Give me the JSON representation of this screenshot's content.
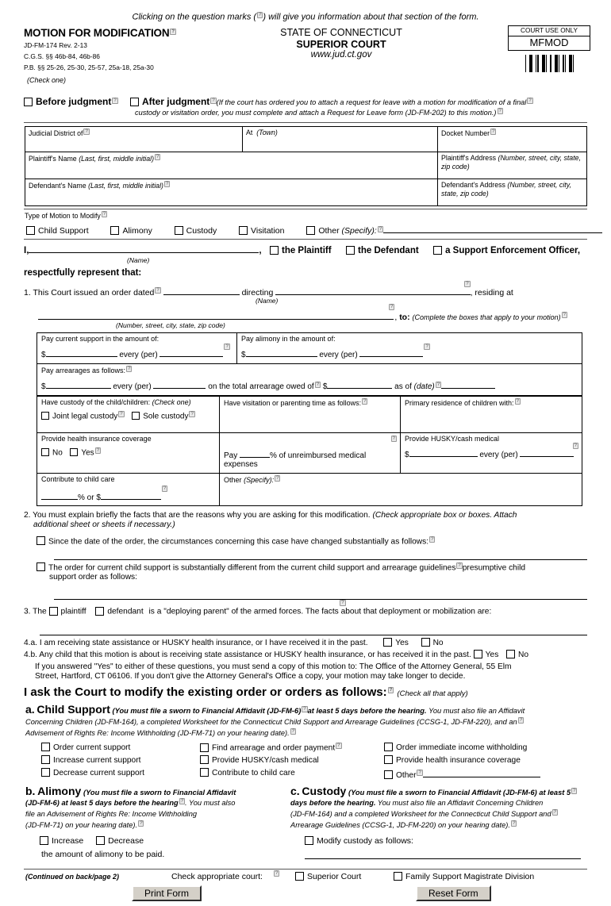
{
  "instruction": "Clicking on the question marks (  ) will give you information about that section of the form.",
  "header": {
    "title": "MOTION FOR MODIFICATION",
    "form_no": "JD-FM-174   Rev. 2-13",
    "cgs": "C.G.S. §§ 46b-84, 46b-86",
    "pb": "P.B. §§ 25-26, 25-30, 25-57, 25a-18, 25a-30",
    "check_one": "(Check one)",
    "state": "STATE OF CONNECTICUT",
    "court": "SUPERIOR COURT",
    "website": "www.jud.ct.gov",
    "court_use_only": "COURT USE ONLY",
    "court_code": "MFMOD"
  },
  "judgment": {
    "before": "Before judgment",
    "after": "After judgment",
    "note_line1": "(If the court has ordered you to attach a request for leave with a motion for modification of a final",
    "note_line2": "custody or visitation order, you must complete and attach a Request for Leave form (JD-FM-202) to this motion.)"
  },
  "case_table": {
    "judicial_district": "Judicial District of",
    "at_town": "At  (Town)",
    "docket_number": "Docket Number",
    "plaintiff_name": "Plaintiff's Name",
    "plaintiff_name_hint": "(Last, first, middle initial)",
    "plaintiff_address": "Plaintiff's Address",
    "plaintiff_address_hint": "(Number, street, city, state, zip code)",
    "defendant_name": "Defendant's Name",
    "defendant_name_hint": "(Last, first, middle initial)",
    "defendant_address": "Defendant's Address",
    "defendant_address_hint": "(Number, street, city, state, zip code)"
  },
  "motion_type": {
    "label": "Type of Motion to Modify",
    "options": [
      "Child Support",
      "Alimony",
      "Custody",
      "Visitation"
    ],
    "other": "Other",
    "other_specify": "(Specify):"
  },
  "party": {
    "i_label": "I,",
    "name_caption": "(Name)",
    "the_plaintiff": "the Plaintiff",
    "the_defendant": "the Defendant",
    "support_officer": "a Support Enforcement Officer,",
    "respectfully": "respectfully represent that:"
  },
  "item1": {
    "prefix": "1. This Court issued an order dated",
    "directing": "directing",
    "name_caption": "(Name)",
    "residing_at": ", residing at",
    "address_caption": "(Number, street, city, state, zip code)",
    "to": "to:",
    "complete_boxes": "(Complete the boxes that apply to your motion)"
  },
  "orders": {
    "pay_current_support": "Pay current support in the amount of:",
    "pay_alimony": "Pay alimony in the amount of:",
    "every_per": "every (per)",
    "dollar": "$",
    "pay_arrearages": "Pay arrearages as follows:",
    "on_total_arrearage": "on the total arrearage owed of",
    "as_of": "as of",
    "date": "(date)",
    "have_custody": "Have custody of the child/children:",
    "check_one": "(Check one)",
    "joint_legal": "Joint legal custody",
    "sole_custody": "Sole custody",
    "visitation": "Have visitation or parenting time as follows:",
    "primary_residence": "Primary residence of children with:",
    "health_insurance": "Provide health insurance coverage",
    "no": "No",
    "yes": "Yes",
    "pay": "Pay",
    "percent_unreimbursed": "% of unreimbursed medical expenses",
    "husky_cash_medical": "Provide HUSKY/cash medical",
    "contribute_child_care": "Contribute to child care",
    "percent_or": "% or",
    "other": "Other",
    "other_specify": "(Specify):"
  },
  "item2": {
    "line1": "2. You must explain briefly the facts that are the reasons why you are asking for this modification.",
    "line1_ital": "(Check appropriate box or boxes. Attach",
    "line2_ital": "additional sheet or sheets if necessary.)",
    "opt1": "Since the date of the order, the circumstances concerning this case have changed substantially as follows:",
    "opt2_a": "The order for current child support is substantially different from the current child support and arrearage guidelines",
    "opt2_b": "presumptive child",
    "opt2_c": "support order as follows:"
  },
  "item3": {
    "prefix": "3. The",
    "plaintiff": "plaintiff",
    "defendant": "defendant",
    "suffix": "is a \"deploying parent\" of the armed forces. The facts about that deployment or mobilization are:"
  },
  "item4": {
    "a": "4.a. I am receiving state assistance or HUSKY health insurance, or I have received it in the past.",
    "b": "4.b. Any child that this motion is about is receiving state assistance or HUSKY health insurance, or has received it in the past.",
    "yes": "Yes",
    "no": "No",
    "note1": "If you answered \"Yes\" to either of these questions, you must send a copy of this motion to: The Office of the Attorney General, 55 Elm",
    "note2": "Street, Hartford, CT 06106. If you don't give the Attorney General's Office a copy, your motion may take longer to decide."
  },
  "ask": {
    "heading": "I ask the Court to modify the existing order or orders as follows:",
    "check_all": "(Check all that apply)"
  },
  "child_support": {
    "letter": "a.",
    "title": "Child Support",
    "note_bold1": "(You must file a sworn to Financial Affidavit (JD-FM-6)",
    "note_bold2": "at least 5 days before the hearing.",
    "note_rest1": "You must also file an Affidavit",
    "note_rest2": "Concerning Children (JD-FM-164), a completed Worksheet for the Connecticut Child Support and Arrearage Guidelines (CCSG-1, JD-FM-220), and an",
    "note_rest3": "Advisement of Rights Re: Income Withholding (JD-FM-71) on your hearing date).",
    "col1": [
      "Order current support",
      "Increase current support",
      "Decrease current support"
    ],
    "col2": [
      "Find arrearage and order payment",
      "Provide HUSKY/cash medical",
      "Contribute to child care"
    ],
    "col3": [
      "Order immediate income withholding",
      "Provide health insurance coverage",
      "Other"
    ]
  },
  "alimony": {
    "letter": "b.",
    "title": "Alimony",
    "note1_bold": "(You must file a sworn to Financial Affidavit",
    "note2_bold": "(JD-FM-6) at least 5 days before the hearing",
    "note2_rest": ". You must also",
    "note3": "file an Advisement of Rights Re: Income Withholding",
    "note4": "(JD-FM-71) on your hearing date).",
    "increase": "Increase",
    "decrease": "Decrease",
    "amount_line": "the amount of alimony to be paid."
  },
  "custody": {
    "letter": "c.",
    "title": "Custody",
    "note1_bold": "(You must file a sworn to Financial Affidavit (JD-FM-6) at least 5",
    "note2_bold": "days before the hearing.",
    "note2_rest": "You must also file an Affidavit Concerning Children",
    "note3": "(JD-FM-164) and a completed Worksheet for the Connecticut Child Support and",
    "note4": "Arrearage Guidelines (CCSG-1, JD-FM-220) on your hearing date).",
    "modify": "Modify custody as follows:"
  },
  "footer": {
    "continued": "(Continued on back/page 2)",
    "check_court": "Check appropriate court:",
    "superior_court": "Superior Court",
    "family_support": "Family Support Magistrate Division",
    "print_form": "Print Form",
    "reset_form": "Reset Form"
  },
  "icons": {
    "question_mark": "?"
  },
  "colors": {
    "rule": "#555555",
    "button_face": "#d4d0c8",
    "question_bg": "#e8e8e8"
  }
}
